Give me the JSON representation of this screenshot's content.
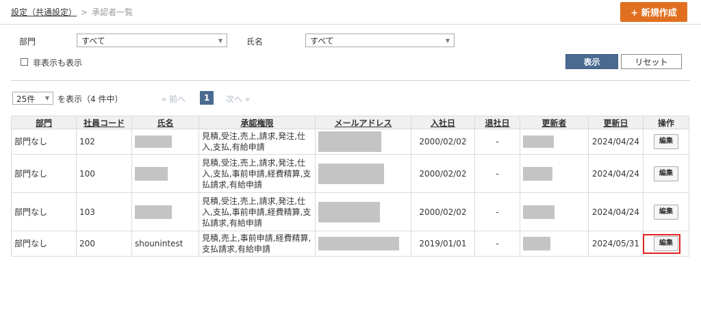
{
  "breadcrumb": {
    "parent": "設定（共通設定）",
    "separator": ">",
    "current": "承認者一覧"
  },
  "header": {
    "new_button": "+ 新規作成"
  },
  "filters": {
    "department_label": "部門",
    "department_value": "すべて",
    "name_label": "氏名",
    "name_value": "すべて",
    "hidden_checkbox_label": "非表示も表示",
    "show_button": "表示",
    "reset_button": "リセット"
  },
  "pager": {
    "page_size": "25件",
    "summary": "を表示（4 件中）",
    "prev": "« 前へ",
    "current_page": "1",
    "next": "次へ »"
  },
  "table": {
    "columns": [
      "部門",
      "社員コード",
      "氏名",
      "承認権限",
      "メールアドレス",
      "入社日",
      "退社日",
      "更新者",
      "更新日",
      "操作"
    ],
    "edit_label": "編集",
    "rows": [
      {
        "department": "部門なし",
        "code": "102",
        "name": "",
        "permissions": "見積,受注,売上,請求,発注,仕入,支払,有給申請",
        "email": "",
        "joined": "2000/02/02",
        "left": "-",
        "updater": "",
        "updated": "2024/04/24"
      },
      {
        "department": "部門なし",
        "code": "100",
        "name": "",
        "permissions": "見積,受注,売上,請求,発注,仕入,支払,事前申請,経費精算,支払請求,有給申請",
        "email": "",
        "joined": "2000/02/02",
        "left": "-",
        "updater": "",
        "updated": "2024/04/24"
      },
      {
        "department": "部門なし",
        "code": "103",
        "name": "",
        "permissions": "見積,受注,売上,請求,発注,仕入,支払,事前申請,経費精算,支払請求,有給申請",
        "email": "",
        "joined": "2000/02/02",
        "left": "-",
        "updater": "",
        "updated": "2024/04/24"
      },
      {
        "department": "部門なし",
        "code": "200",
        "name": "shounintest",
        "permissions": "見積,売上,事前申請,経費精算,支払請求,有給申請",
        "email": "",
        "joined": "2019/01/01",
        "left": "-",
        "updater": "",
        "updated": "2024/05/31"
      }
    ]
  }
}
